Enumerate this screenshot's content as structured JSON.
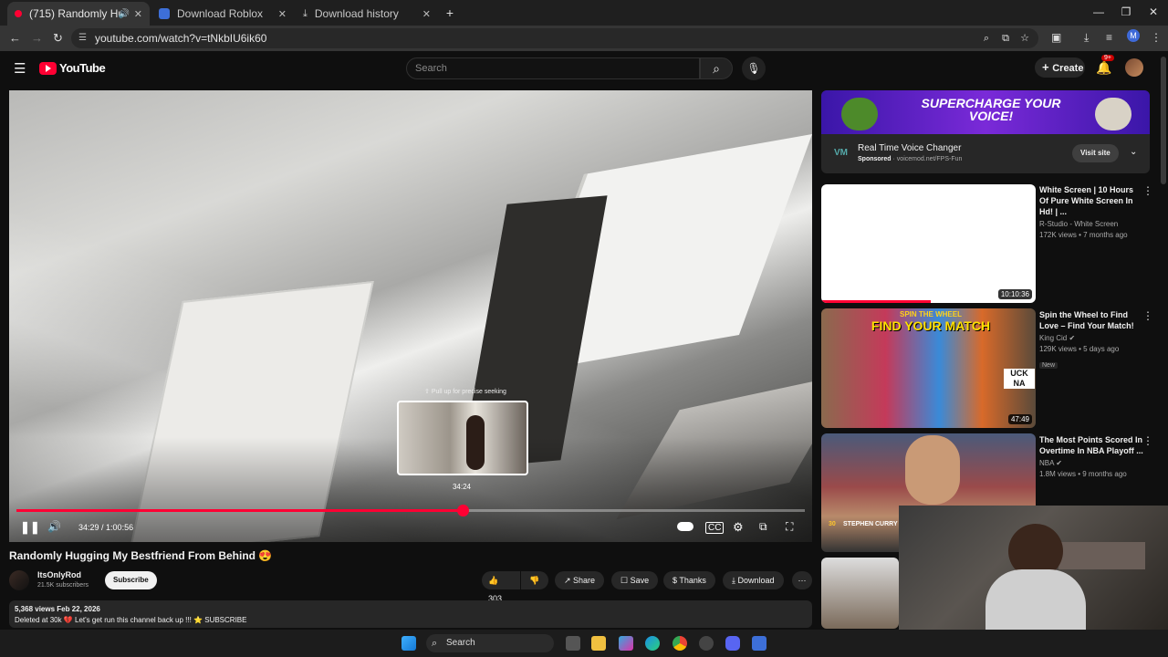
{
  "browser": {
    "tabs": [
      {
        "title": "(715) Randomly Hugging M",
        "active": true
      },
      {
        "title": "Download Roblox",
        "active": false
      },
      {
        "title": "Download history",
        "active": false
      }
    ],
    "url": "youtube.com/watch?v=tNkbIU6ik60",
    "profile_initial": "M"
  },
  "header": {
    "logo_text": "YouTube",
    "search_placeholder": "Search",
    "create_label": "Create",
    "notif_count": "9+"
  },
  "player": {
    "time_current": "34:29",
    "time_total": "1:00:56",
    "progress": 0.566,
    "seek_hint": "Pull up for precise seeking",
    "preview_time": "34:24"
  },
  "video": {
    "title": "Randomly Hugging My Bestfriend From Behind 😍",
    "channel": "ItsOnlyRod",
    "subscribers": "21.5K subscribers",
    "subscribe_label": "Subscribe",
    "likes": "303",
    "share_label": "Share",
    "save_label": "Save",
    "thanks_label": "Thanks",
    "download_label": "Download",
    "views_date": "5,368 views  Feb 22, 2026",
    "description": "Deleted at 30k 💔 Let's get run this channel back up !!! ⭐ SUBSCRIBE"
  },
  "ad": {
    "banner_text": "SUPERCHARGE YOUR VOICE!",
    "title": "Real Time Voice Changer",
    "sponsored": "Sponsored",
    "domain": "voicemod.net/FPS-Fun",
    "cta": "Visit site"
  },
  "recommendations": [
    {
      "title": "White Screen | 10 Hours Of Pure White Screen In Hd! | ...",
      "channel": "R-Studio - White Screen",
      "stats": "172K views • 7 months ago",
      "duration": "10:10:36",
      "badge": ""
    },
    {
      "title": "Spin the Wheel to Find Love – Find Your Match!",
      "channel": "King Cid",
      "stats": "129K views • 5 days ago",
      "duration": "47:49",
      "badge": "New",
      "thumb_text": "FIND YOUR MATCH",
      "thumb_text_top": "SPIN THE WHEEL",
      "thumb_sign": "UCK NA"
    },
    {
      "title": "The Most Points Scored In Overtime In NBA Playoff ...",
      "channel": "NBA",
      "stats": "1.8M views • 9 months ago",
      "duration": "",
      "badge": "",
      "thumb_text": "STEPHEN CURRY",
      "thumb_num": "30"
    }
  ],
  "taskbar": {
    "search_label": "Search"
  }
}
